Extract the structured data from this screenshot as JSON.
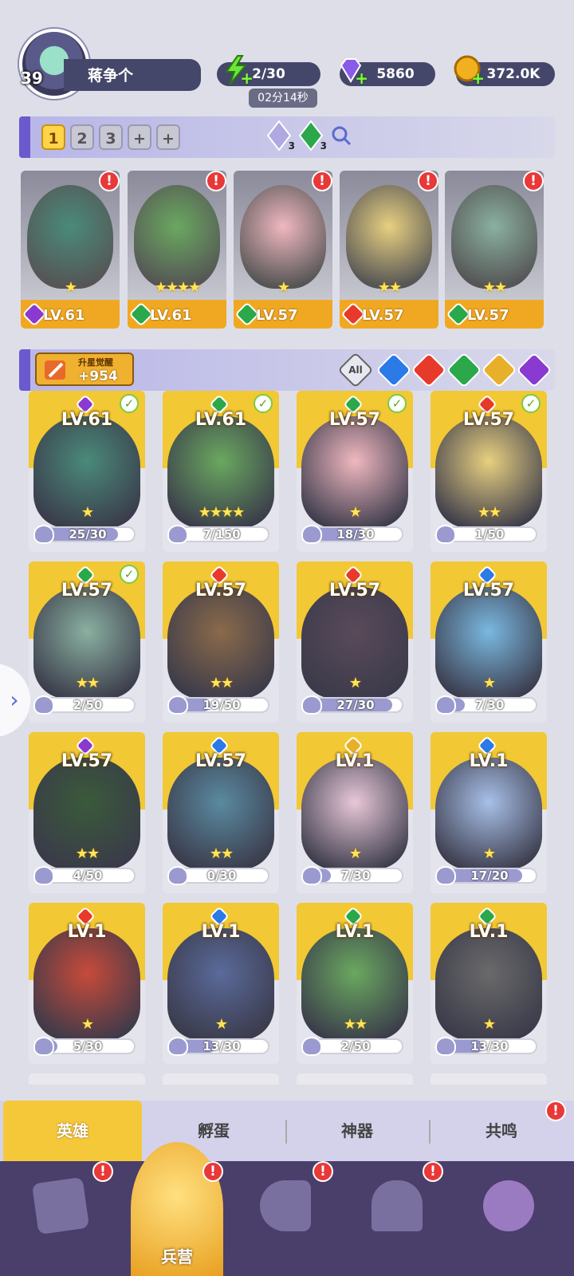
{
  "player": {
    "level": "39",
    "name": "蒋争个"
  },
  "resources": {
    "energy": {
      "value": "2/30",
      "icon": "lightning-icon",
      "timer": "02分14秒"
    },
    "gems": {
      "value": "5860",
      "icon": "gem-icon"
    },
    "gold": {
      "value": "372.0K",
      "icon": "coin-icon"
    }
  },
  "team_tabs": [
    "1",
    "2",
    "3",
    "+",
    "+"
  ],
  "team_gems": {
    "light": "3",
    "nature": "3"
  },
  "team": [
    {
      "lv": "LV.61",
      "element": "dark",
      "stars": "★",
      "alert": "!"
    },
    {
      "lv": "LV.61",
      "element": "nature",
      "stars": "★★★★",
      "alert": "!"
    },
    {
      "lv": "LV.57",
      "element": "nature",
      "stars": "★",
      "alert": "!"
    },
    {
      "lv": "LV.57",
      "element": "fire",
      "stars": "★★",
      "alert": "!"
    },
    {
      "lv": "LV.57",
      "element": "nature",
      "stars": "★★",
      "alert": "!"
    }
  ],
  "awaken": {
    "title": "升星觉醒",
    "value": "+954"
  },
  "filters": {
    "all": "All",
    "items": [
      "water",
      "fire",
      "nature",
      "light",
      "dark"
    ]
  },
  "heroes": [
    {
      "lv": "LV.61",
      "element": "dark",
      "progress": "25/30",
      "ratio": 0.83,
      "checked": true,
      "stars": "★"
    },
    {
      "lv": "LV.61",
      "element": "nature",
      "progress": "7/150",
      "ratio": 0.05,
      "checked": true,
      "stars": "★★★★"
    },
    {
      "lv": "LV.57",
      "element": "nature",
      "progress": "18/30",
      "ratio": 0.6,
      "checked": true,
      "stars": "★"
    },
    {
      "lv": "LV.57",
      "element": "fire",
      "progress": "1/50",
      "ratio": 0.02,
      "checked": true,
      "stars": "★★"
    },
    {
      "lv": "LV.57",
      "element": "nature",
      "progress": "2/50",
      "ratio": 0.04,
      "checked": true,
      "stars": "★★"
    },
    {
      "lv": "LV.57",
      "element": "fire",
      "progress": "19/50",
      "ratio": 0.38,
      "checked": false,
      "stars": "★★"
    },
    {
      "lv": "LV.57",
      "element": "fire",
      "progress": "27/30",
      "ratio": 0.9,
      "checked": false,
      "stars": "★"
    },
    {
      "lv": "LV.57",
      "element": "water",
      "progress": "7/30",
      "ratio": 0.23,
      "checked": false,
      "stars": "★"
    },
    {
      "lv": "LV.57",
      "element": "dark",
      "progress": "4/50",
      "ratio": 0.08,
      "checked": false,
      "stars": "★★"
    },
    {
      "lv": "LV.57",
      "element": "water",
      "progress": "0/30",
      "ratio": 0,
      "checked": false,
      "stars": "★★"
    },
    {
      "lv": "LV.1",
      "element": "light",
      "progress": "7/30",
      "ratio": 0.23,
      "checked": false,
      "stars": "★"
    },
    {
      "lv": "LV.1",
      "element": "water",
      "progress": "17/20",
      "ratio": 0.85,
      "checked": false,
      "stars": "★"
    },
    {
      "lv": "LV.1",
      "element": "fire",
      "progress": "5/30",
      "ratio": 0.17,
      "checked": false,
      "stars": "★"
    },
    {
      "lv": "LV.1",
      "element": "water",
      "progress": "13/30",
      "ratio": 0.43,
      "checked": false,
      "stars": "★"
    },
    {
      "lv": "LV.1",
      "element": "nature",
      "progress": "2/50",
      "ratio": 0.04,
      "checked": false,
      "stars": "★★"
    },
    {
      "lv": "LV.1",
      "element": "nature",
      "progress": "13/30",
      "ratio": 0.43,
      "checked": false,
      "stars": "★"
    }
  ],
  "colors": {
    "water": "#2a7ae8",
    "fire": "#e83a2a",
    "nature": "#2aa84a",
    "light": "#e8b02a",
    "dark": "#8a3ad0"
  },
  "bottom_tabs": [
    {
      "label": "英雄",
      "active": true
    },
    {
      "label": "孵蛋",
      "active": false
    },
    {
      "label": "神器",
      "active": false
    },
    {
      "label": "共鸣",
      "active": false,
      "alert": "!"
    }
  ],
  "nav": {
    "items": [
      {
        "icon": "cards-icon",
        "alert": "!"
      },
      {
        "icon": "barracks-icon",
        "alert": "!",
        "label": "兵营"
      },
      {
        "icon": "map-icon",
        "alert": "!"
      },
      {
        "icon": "castle-icon",
        "alert": "!"
      },
      {
        "icon": "mushroom-icon"
      }
    ]
  },
  "side_arrow": "›",
  "art_colors": [
    "#4a8a7a",
    "#6aa860",
    "#f0b8c0",
    "#e8d080",
    "#8ab0a0",
    "#8a6a4a",
    "#5a4a5a",
    "#7ab8e0",
    "#3a5a3a",
    "#5a8aa0",
    "#e8c8d8",
    "#a8c0e8",
    "#c84a3a",
    "#5a6a9a",
    "#6aa860",
    "#6a6a6a"
  ]
}
